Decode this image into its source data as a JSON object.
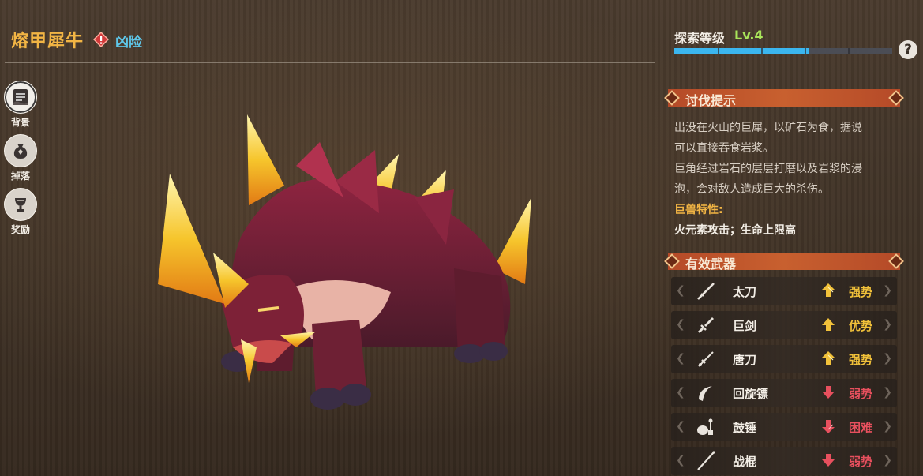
{
  "header": {
    "monster_name": "熔甲犀牛",
    "danger_label": "凶险",
    "explore_label": "探索等级",
    "explore_level": "Lv.4",
    "explore_progress": 0.62,
    "help_symbol": "?"
  },
  "nav": [
    {
      "label": "背景",
      "icon": "scroll-icon",
      "active": true
    },
    {
      "label": "掉落",
      "icon": "loot-bag-icon",
      "active": false
    },
    {
      "label": "奖励",
      "icon": "trophy-icon",
      "active": false
    }
  ],
  "hunting_tips": {
    "title": "讨伐提示",
    "lines": [
      "出没在火山的巨犀，以矿石为食，据说",
      "可以直接吞食岩浆。",
      "巨角经过岩石的层层打磨以及岩浆的浸",
      "泡，会对敌人造成巨大的杀伤。"
    ],
    "traits_label": "巨兽特性:",
    "traits": "火元素攻击；生命上限高"
  },
  "weapons": {
    "title": "有效武器",
    "items": [
      {
        "name": "太刀",
        "effect": "强势",
        "trend": "up-double",
        "icon": "katana-icon"
      },
      {
        "name": "巨剑",
        "effect": "优势",
        "trend": "up",
        "icon": "greatsword-icon"
      },
      {
        "name": "唐刀",
        "effect": "强势",
        "trend": "up-double",
        "icon": "tang-sword-icon"
      },
      {
        "name": "回旋镖",
        "effect": "弱势",
        "trend": "down",
        "icon": "boomerang-icon"
      },
      {
        "name": "鼓锤",
        "effect": "困难",
        "trend": "down-double",
        "icon": "drum-hammer-icon"
      },
      {
        "name": "战棍",
        "effect": "弱势",
        "trend": "down",
        "icon": "war-staff-icon"
      }
    ]
  },
  "colors": {
    "accent_gold": "#f2b544",
    "danger_blue": "#5ec6e8",
    "level_green": "#a8e45a",
    "progress_blue": "#3bb6ef",
    "up_color": "#f2c23a",
    "down_color": "#e8505e"
  }
}
